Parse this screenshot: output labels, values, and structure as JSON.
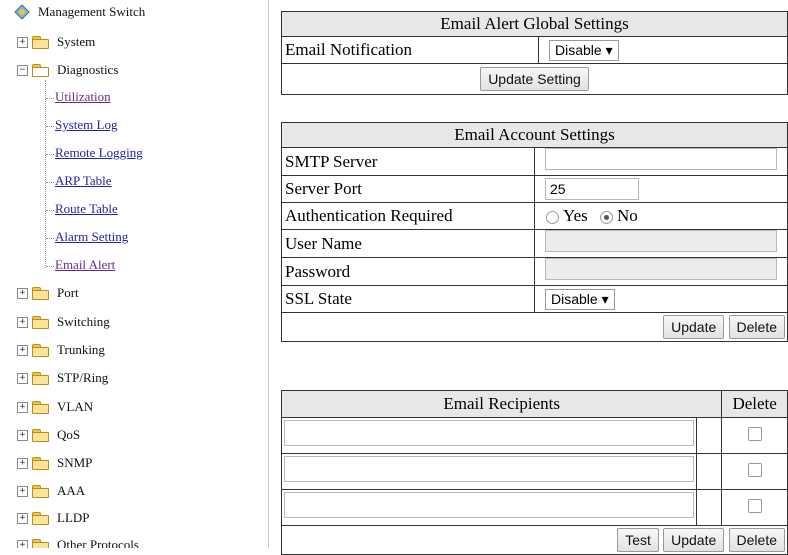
{
  "sidebar": {
    "root": "Management Switch",
    "system": "System",
    "diagnostics": "Diagnostics",
    "diag_items": [
      "Utilization",
      "System Log",
      "Remote Logging",
      "ARP Table",
      "Route Table",
      "Alarm Setting",
      "Email Alert"
    ],
    "folders": [
      "Port",
      "Switching",
      "Trunking",
      "STP/Ring",
      "VLAN",
      "QoS",
      "SNMP",
      "AAA",
      "LLDP",
      "Other Protocols"
    ]
  },
  "global": {
    "title": "Email Alert Global Settings",
    "notification_label": "Email Notification",
    "notification_value": "Disable ▾",
    "update_button": "Update Setting"
  },
  "account": {
    "title": "Email Account Settings",
    "smtp_label": "SMTP Server",
    "smtp_value": "",
    "port_label": "Server Port",
    "port_value": "25",
    "auth_label": "Authentication Required",
    "auth_yes": "Yes",
    "auth_no": "No",
    "user_label": "User Name",
    "password_label": "Password",
    "ssl_label": "SSL State",
    "ssl_value": "Disable ▾",
    "update_button": "Update",
    "delete_button": "Delete"
  },
  "recipients": {
    "title": "Email Recipients",
    "delete_header": "Delete",
    "test_button": "Test",
    "update_button": "Update",
    "delete_button": "Delete"
  }
}
